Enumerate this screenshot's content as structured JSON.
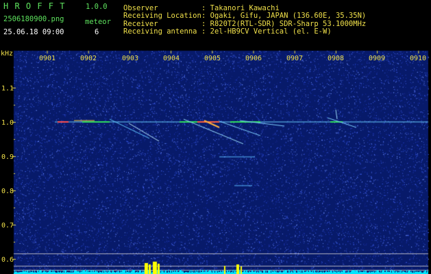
{
  "app": {
    "title_letters": "H R O F F T",
    "version": "1.0.0",
    "filename": "2506180900.png",
    "datetime": "25.06.18 09:00",
    "meteor_label": "meteor",
    "meteor_count": "6"
  },
  "info": {
    "rows": [
      {
        "key": "Observer",
        "value": ": Takanori Kawachi"
      },
      {
        "key": "Receiving Location",
        "value": ": Ogaki, Gifu, JAPAN (136.60E, 35.35N)"
      },
      {
        "key": "Receiver",
        "value": ": R820T2(RTL-SDR) SDR-Sharp 53.1000MHz"
      },
      {
        "key": "Receiving antenna",
        "value": ": 2el-HB9CV Vertical (el. E-W)"
      }
    ]
  },
  "axes": {
    "unit": "kHz",
    "y_ticks": [
      "1.1",
      "1.0",
      "0.9",
      "0.8",
      "0.7",
      "0.6"
    ],
    "x_ticks": [
      "0901",
      "0902",
      "0903",
      "0904",
      "0905",
      "0906",
      "0907",
      "0908",
      "0909",
      "0910"
    ]
  },
  "colors": {
    "background": "#000000",
    "plot_bg": "#071a6a",
    "green_text": "#5ee35e",
    "yellow_text": "#f0e04a",
    "carrier": "#6ad0ff",
    "level_bar": "#00e6ff",
    "level_peak": "#ffff00"
  },
  "chart_data": {
    "type": "heatmap",
    "xlabel": "",
    "ylabel": "kHz",
    "ylim": [
      0.58,
      1.2
    ],
    "xlim": [
      "0900:30",
      "0910:00"
    ],
    "carrier_khz": 1.0,
    "meteor_count": 6
  }
}
